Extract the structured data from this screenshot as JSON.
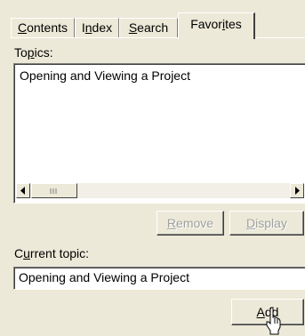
{
  "tabs": [
    {
      "label": "Contents",
      "accel": "C"
    },
    {
      "label": "Index",
      "accel": "n"
    },
    {
      "label": "Search",
      "accel": "S"
    },
    {
      "label": "Favorites",
      "accel": "i"
    }
  ],
  "active_tab": "Favorites",
  "topics": {
    "label": "Topics:",
    "items": [
      "Opening and Viewing a Project"
    ]
  },
  "buttons": {
    "remove": "Remove",
    "display": "Display",
    "add": "Add"
  },
  "current_topic": {
    "label": "Current topic:",
    "value": "Opening and Viewing a Project"
  },
  "icons": {
    "scroll_left": "arrow-left-icon",
    "scroll_right": "arrow-right-icon",
    "cursor": "mouse-pointer-icon"
  }
}
